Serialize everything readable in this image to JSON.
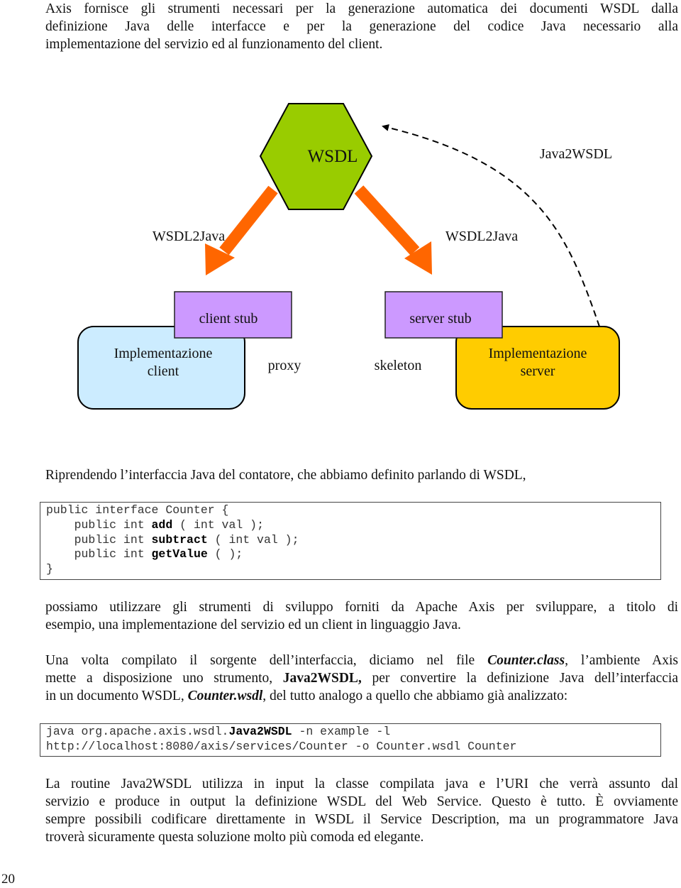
{
  "intro": {
    "lines": [
      "Axis fornisce gli strumenti necessari per la generazione automatica dei documenti WSDL dalla",
      "definizione Java delle interfacce e per la generazione del codice Java necessario alla",
      "implementazione del servizio ed al funzionamento del client."
    ]
  },
  "diagram": {
    "wsdl_label": "WSDL",
    "java2wsdl_label": "Java2WSDL",
    "wsdl2java_left_label": "WSDL2Java",
    "wsdl2java_right_label": "WSDL2Java",
    "client_stub_label": "client stub",
    "server_stub_label": "server stub",
    "impl_client_line1": "Implementazione",
    "impl_client_line2": "client",
    "impl_server_line1": "Implementazione",
    "impl_server_line2": "server",
    "proxy_label": "proxy",
    "skeleton_label": "skeleton",
    "colors": {
      "wsdl_fill": "#99CC00",
      "arrow": "#FF6600",
      "stub_fill": "#CC99FF",
      "impl_client_fill": "#CCECFF",
      "impl_server_fill": "#FFCC00"
    }
  },
  "lead_in": "Riprendendo l’interfaccia Java del contatore, che abbiamo definito parlando di WSDL,",
  "interface_code": {
    "line1": "public interface Counter {",
    "indent": "    ",
    "kw": "public int ",
    "m1_name": "add",
    "m1_rest": " ( int val );",
    "m2_name": "subtract",
    "m2_rest": " ( int val );",
    "m3_name": "getValue",
    "m3_rest": " ( );",
    "close": "}"
  },
  "para2": {
    "lines": [
      "possiamo utilizzare gli strumenti di sviluppo forniti da Apache Axis per sviluppare, a titolo di",
      "esempio, una implementazione del servizio ed un client in linguaggio Java."
    ]
  },
  "para3": {
    "l1_a": "Una volta compilato il sorgente dell’interfaccia, diciamo nel file ",
    "l1_em": "Counter.class",
    "l1_b": ", l’ambiente Axis",
    "l2_a": "mette a disposizione uno strumento, ",
    "l2_strong": "Java2WSDL,",
    "l2_b": " per convertire la definizione Java dell’interfaccia",
    "l3_a": "in un documento WSDL, ",
    "l3_em": "Counter.wsdl",
    "l3_b": ", del tutto analogo a quello che abbiamo già analizzato:"
  },
  "command_code": {
    "l1_a": "java org.apache.axis.wsdl.",
    "l1_bold": "Java2WSDL",
    "l1_b": " -n example -l",
    "l2": "http://localhost:8080/axis/services/Counter -o Counter.wsdl Counter"
  },
  "para4": {
    "lines": [
      "La routine Java2WSDL utilizza in input la classe compilata java e l’URI che verrà assunto dal",
      "servizio e produce in output la definizione WSDL del Web Service. Questo è tutto. È ovviamente",
      "sempre possibili codificare direttamente in WSDL il Service Description, ma un programmatore Java",
      "troverà sicuramente questa soluzione molto più comoda ed elegante."
    ]
  },
  "page_number": "20"
}
